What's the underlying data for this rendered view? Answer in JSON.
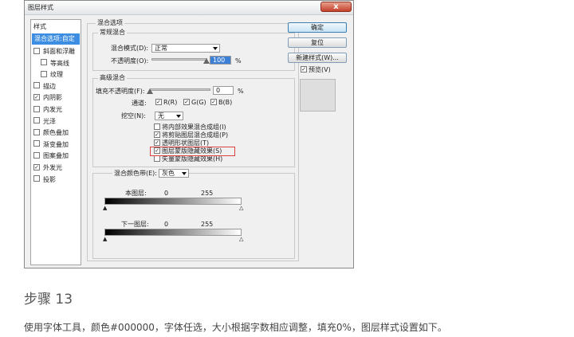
{
  "dialog": {
    "title": "图层样式",
    "close_label": "x"
  },
  "styles_panel": {
    "header": "样式",
    "blend_options": "混合选项:自定",
    "items": [
      {
        "label": "斜面和浮雕",
        "checked": false,
        "sub": false
      },
      {
        "label": "等高线",
        "checked": false,
        "sub": true
      },
      {
        "label": "纹理",
        "checked": false,
        "sub": true
      },
      {
        "label": "描边",
        "checked": false,
        "sub": false
      },
      {
        "label": "内阴影",
        "checked": true,
        "sub": false
      },
      {
        "label": "内发光",
        "checked": false,
        "sub": false
      },
      {
        "label": "光泽",
        "checked": false,
        "sub": false
      },
      {
        "label": "颜色叠加",
        "checked": false,
        "sub": false
      },
      {
        "label": "渐变叠加",
        "checked": false,
        "sub": false
      },
      {
        "label": "图案叠加",
        "checked": false,
        "sub": false
      },
      {
        "label": "外发光",
        "checked": true,
        "sub": false
      },
      {
        "label": "投影",
        "checked": false,
        "sub": false
      }
    ]
  },
  "blending": {
    "section_title": "混合选项",
    "general": {
      "legend": "常规混合",
      "mode_label": "混合模式(D):",
      "mode_value": "正常",
      "opacity_label": "不透明度(O):",
      "opacity_value": "100",
      "opacity_unit": "%"
    },
    "advanced": {
      "legend": "高级混合",
      "fill_label": "填充不透明度(F):",
      "fill_value": "0",
      "fill_unit": "%",
      "channels_label": "通道:",
      "channels": [
        {
          "label": "R(R)",
          "checked": true
        },
        {
          "label": "G(G)",
          "checked": true
        },
        {
          "label": "B(B)",
          "checked": true
        }
      ],
      "knockout_label": "挖空(N):",
      "knockout_value": "无",
      "options": [
        {
          "label": "将内部效果混合成组(I)",
          "checked": false
        },
        {
          "label": "将剪贴图层混合成组(P)",
          "checked": true
        },
        {
          "label": "透明形状图层(T)",
          "checked": true
        },
        {
          "label": "图层蒙版隐藏效果(S)",
          "checked": true
        },
        {
          "label": "矢量蒙版隐藏效果(H)",
          "checked": false
        }
      ]
    },
    "blend_if": {
      "label": "混合颜色带(E):",
      "value": "灰色",
      "this_layer_label": "本图层:",
      "this_layer_min": "0",
      "this_layer_max": "255",
      "underlying_label": "下一图层:",
      "underlying_min": "0",
      "underlying_max": "255"
    }
  },
  "buttons": {
    "ok": "确定",
    "cancel": "复位",
    "new_style": "新建样式(W)...",
    "preview_label": "预览(V)",
    "preview_checked": true
  },
  "caption": {
    "step": "步骤 13",
    "description": "使用字体工具，颜色#000000，字体任选，大小根据字数相应调整，填充0%，图层样式设置如下。"
  }
}
